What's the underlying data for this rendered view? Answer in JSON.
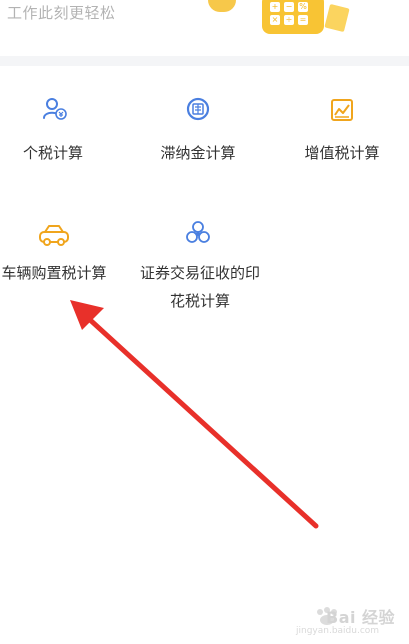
{
  "header": {
    "subtitle": "工作此刻更轻松"
  },
  "tools": [
    {
      "label": "个税计算",
      "icon": "person-tax-icon"
    },
    {
      "label": "滞纳金计算",
      "icon": "late-fee-icon"
    },
    {
      "label": "增值税计算",
      "icon": "chart-trend-icon"
    },
    {
      "label": "车辆购置税计算",
      "icon": "car-icon"
    },
    {
      "label_line1": "证券交易征收的印",
      "label_line2": "花税计算",
      "icon": "flower-icon"
    }
  ],
  "watermark": {
    "brand": "Bai 经验",
    "url": "jingyan.baidu.com"
  },
  "colors": {
    "icon_blue": "#4a7fe0",
    "icon_orange": "#f0a51d",
    "arrow_red": "#e8302a",
    "text": "#333333",
    "subtitle": "#b3b3b3"
  }
}
